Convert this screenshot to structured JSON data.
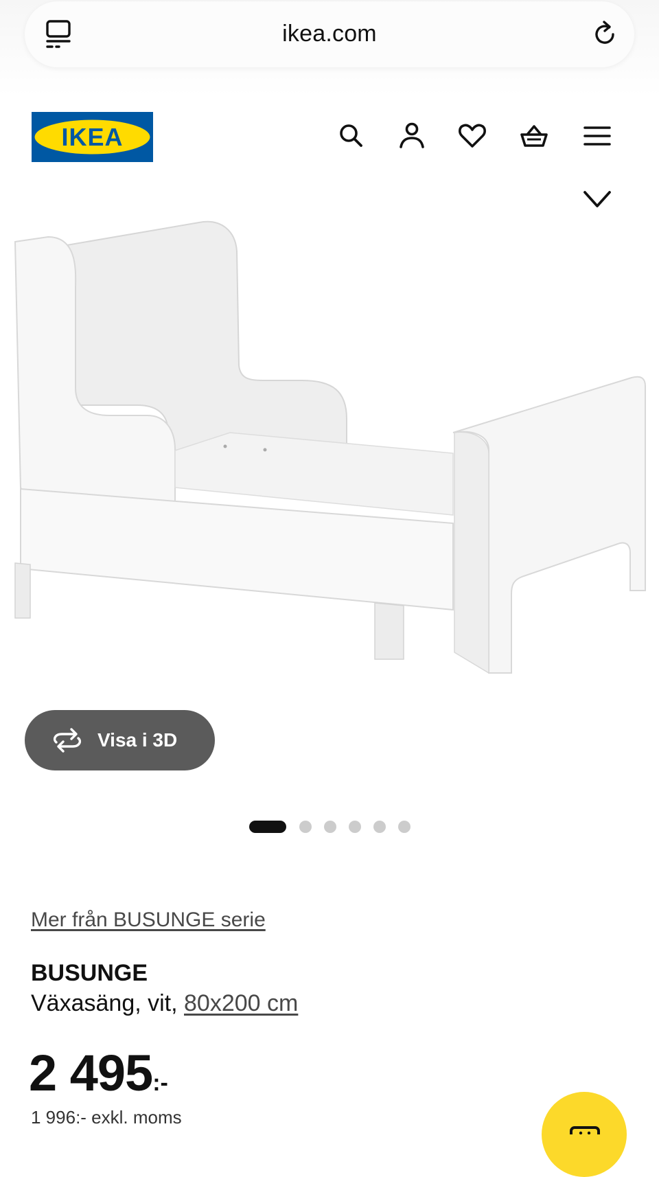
{
  "browser": {
    "url": "ikea.com"
  },
  "header": {
    "logo_text": "IKEA",
    "icons": [
      "search-icon",
      "account-icon",
      "heart-icon",
      "cart-icon",
      "menu-icon"
    ]
  },
  "product": {
    "view_3d_label": "Visa i 3D",
    "carousel": {
      "total": 6,
      "active": 1
    },
    "series_link": "Mer från BUSUNGE serie",
    "name": "BUSUNGE",
    "description_prefix": "Växasäng, vit, ",
    "size_link": "80x200 cm",
    "price": "2 495",
    "price_suffix": ":-",
    "price_ex_vat": "1 996:- exkl. moms"
  },
  "colors": {
    "ikea_blue": "#0058a3",
    "ikea_yellow": "#ffdb00",
    "button_gray": "#5b5b5b",
    "fab_yellow": "#fcd92a"
  }
}
